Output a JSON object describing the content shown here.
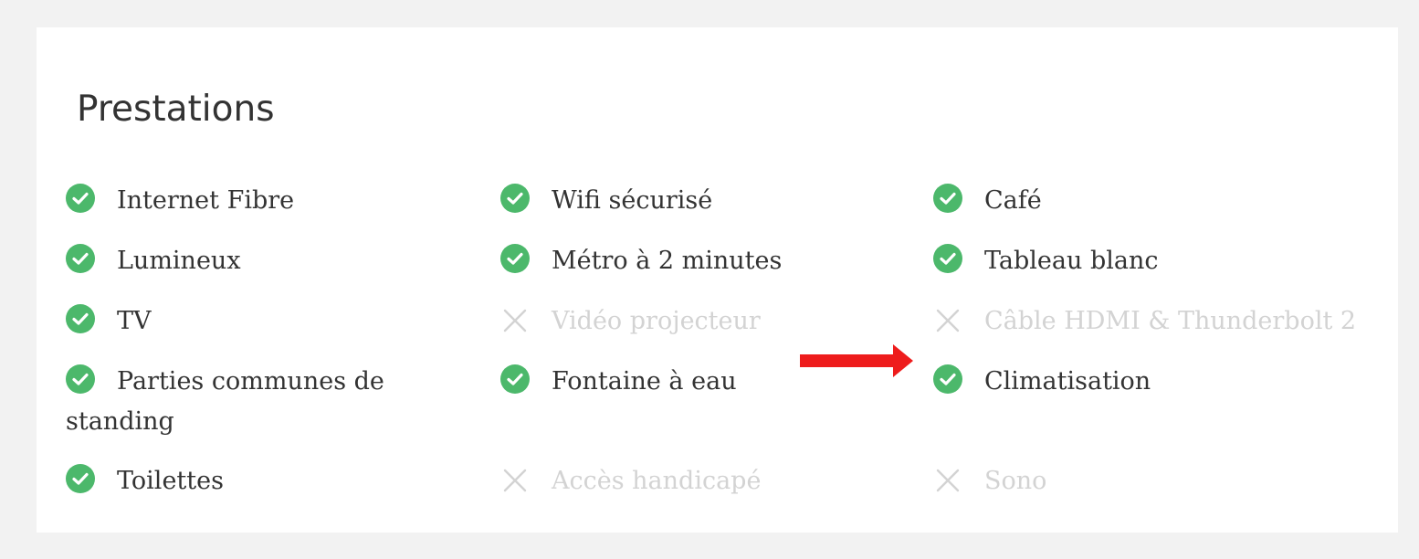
{
  "section": {
    "title": "Prestations"
  },
  "amenities": {
    "internet_fibre": {
      "label": "Internet Fibre",
      "available": true
    },
    "wifi_securise": {
      "label": "Wifi sécurisé",
      "available": true
    },
    "cafe": {
      "label": "Café",
      "available": true
    },
    "lumineux": {
      "label": "Lumineux",
      "available": true
    },
    "metro": {
      "label": "Métro à 2 minutes",
      "available": true
    },
    "tableau_blanc": {
      "label": "Tableau blanc",
      "available": true
    },
    "tv": {
      "label": "TV",
      "available": true
    },
    "video_projecteur": {
      "label": "Vidéo projecteur",
      "available": false
    },
    "cable_hdmi": {
      "label": "Câble HDMI & Thunderbolt 2",
      "available": false
    },
    "parties_communes": {
      "label": "Parties communes de standing",
      "available": true
    },
    "fontaine": {
      "label": "Fontaine à eau",
      "available": true
    },
    "climatisation": {
      "label": "Climatisation",
      "available": true
    },
    "toilettes": {
      "label": "Toilettes",
      "available": true
    },
    "acces_handicape": {
      "label": "Accès handicapé",
      "available": false
    },
    "sono": {
      "label": "Sono",
      "available": false
    }
  },
  "colors": {
    "available_icon": "#4cb86b",
    "unavailable": "#d3d3d3",
    "text": "#333333",
    "arrow": "#ee1c1c"
  },
  "icons": {
    "available": "check-circle-icon",
    "unavailable": "cross-icon",
    "annotation": "red-arrow"
  }
}
